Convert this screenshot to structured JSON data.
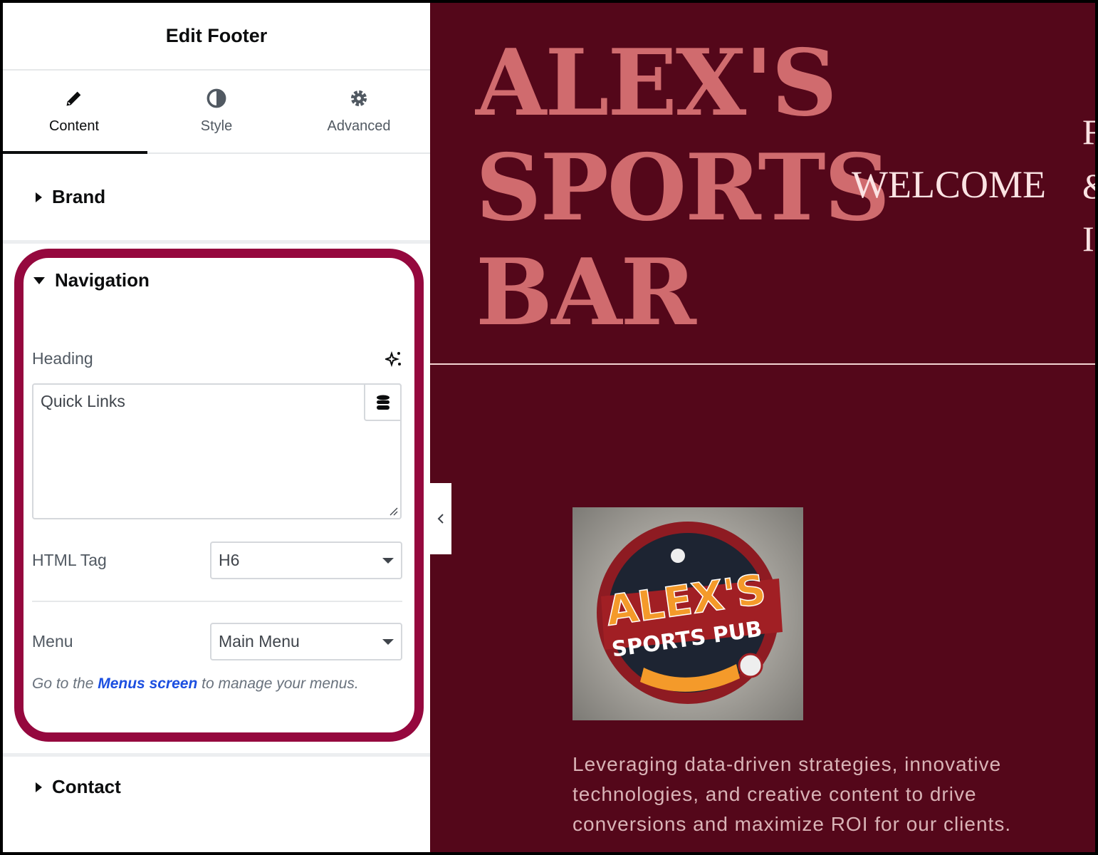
{
  "panel": {
    "title": "Edit Footer",
    "tabs": [
      {
        "label": "Content",
        "icon": "pencil-icon",
        "active": true
      },
      {
        "label": "Style",
        "icon": "half-circle-icon"
      },
      {
        "label": "Advanced",
        "icon": "gear-icon"
      }
    ],
    "sections": {
      "brand": "Brand",
      "navigation": "Navigation",
      "contact": "Contact"
    },
    "navigation": {
      "heading_label": "Heading",
      "heading_value": "Quick Links",
      "html_tag_label": "HTML Tag",
      "html_tag_value": "H6",
      "menu_label": "Menu",
      "menu_value": "Main Menu",
      "hint_before": "Go to the ",
      "hint_link": "Menus screen",
      "hint_after": " to manage your menus."
    },
    "highlight_color": "#95083e"
  },
  "site": {
    "title_lines": [
      "ALEX'S",
      "SPORTS",
      "BAR"
    ],
    "welcome": "WELCOME",
    "side_letters": [
      "F",
      "&",
      "I"
    ],
    "logo_text": "ALEX'S SPORTS PUB",
    "paragraph": "Leveraging data-driven strategies, innovative technologies, and creative content to drive conversions and maximize ROI for our clients.",
    "background": "#54071a"
  }
}
